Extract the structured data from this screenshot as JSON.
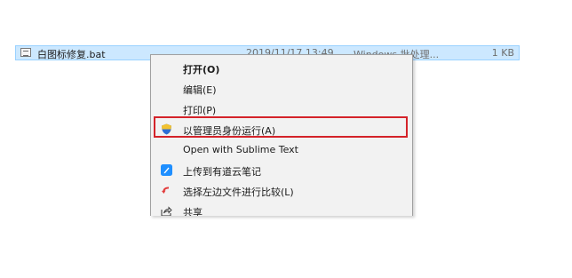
{
  "file": {
    "name": "白图标修复.bat",
    "date": "2019/11/17 13:49",
    "type": "Windows 批处理...",
    "size": "1 KB"
  },
  "menu": {
    "items": [
      {
        "label": "打开(O)",
        "icon": "",
        "bold": true
      },
      {
        "label": "编辑(E)",
        "icon": ""
      },
      {
        "label": "打印(P)",
        "icon": ""
      },
      {
        "label": "以管理员身份运行(A)",
        "icon": "uac-shield-icon",
        "highlighted": true
      },
      {
        "label": "Open with Sublime Text",
        "icon": ""
      },
      {
        "label": "上传到有道云笔记",
        "icon": "youdao-note-icon"
      },
      {
        "label": "选择左边文件进行比较(L)",
        "icon": "compare-icon"
      },
      {
        "label": "共享",
        "icon": "share-icon"
      }
    ]
  },
  "colors": {
    "selection_bg": "#cce8ff",
    "selection_border": "#99d1ff",
    "menu_bg": "#f2f2f2",
    "highlight_red": "#d4232a",
    "youdao_blue": "#1f8fff"
  }
}
